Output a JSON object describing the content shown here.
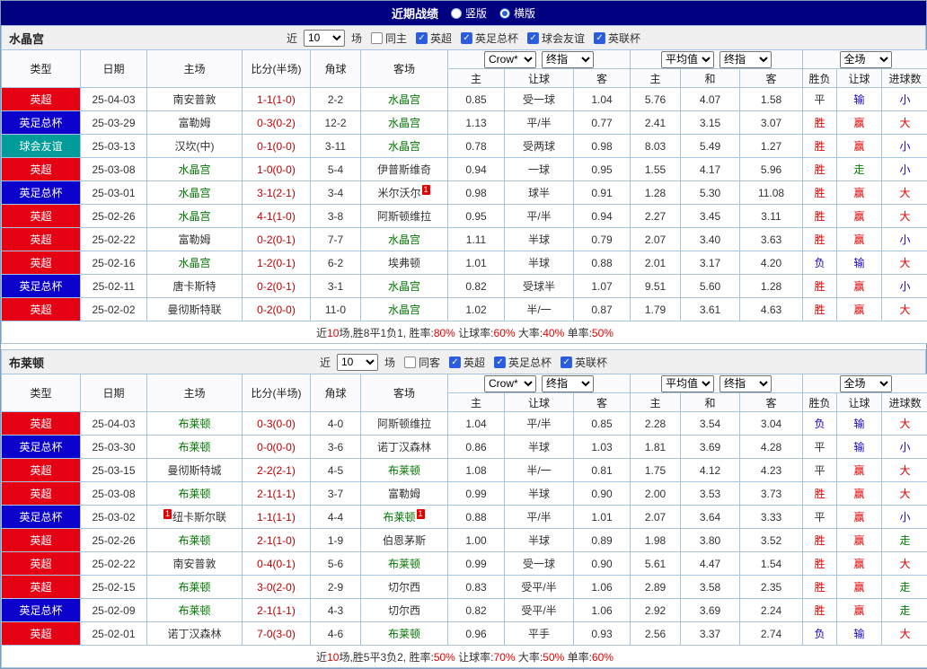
{
  "topbar": {
    "title": "近期战绩",
    "vertical_label": "竖版",
    "horizontal_label": "横版",
    "selected": "横版"
  },
  "table_headers": {
    "columns": [
      "类型",
      "日期",
      "主场",
      "比分(半场)",
      "角球",
      "客场"
    ],
    "odds_groups": [
      {
        "selects": [
          "Crow*",
          "终指"
        ],
        "subs": [
          "主",
          "让球",
          "客"
        ]
      },
      {
        "selects": [
          "平均值",
          "终指"
        ],
        "subs": [
          "主",
          "和",
          "客"
        ]
      },
      {
        "selects": [
          "全场"
        ],
        "subs": [
          "胜负",
          "让球",
          "进球数"
        ]
      }
    ]
  },
  "colors": {
    "topbar_bg": "#000080",
    "control_accent": "#2b5ce0",
    "badge": "#e60000",
    "score": "#bb0000",
    "focus_team": "#007500",
    "summary_highlight": "#e60000",
    "league": {
      "英超": "#e60014",
      "英足总杯": "#0c00cd",
      "球会友谊": "#009c9c"
    },
    "result": {
      "胜": "#e60000",
      "赢": "#e60000",
      "大": "#e60000",
      "平": "#333333",
      "负": "#1500cd",
      "输": "#1500cd",
      "小": "#1500cd",
      "走": "#008000"
    }
  },
  "sections": [
    {
      "team": "水晶宫",
      "filters": {
        "near": "近",
        "count": "10",
        "games": "场",
        "boxes": [
          {
            "label": "同主",
            "checked": false
          },
          {
            "label": "英超",
            "checked": true
          },
          {
            "label": "英足总杯",
            "checked": true
          },
          {
            "label": "球会友谊",
            "checked": true
          },
          {
            "label": "英联杯",
            "checked": true
          }
        ]
      },
      "rows": [
        {
          "league": "英超",
          "date": "25-04-03",
          "home": "南安普敦",
          "home_focus": false,
          "score": "1-1(1-0)",
          "corners": "2-2",
          "away": "水晶宫",
          "away_focus": true,
          "odds": [
            "0.85",
            "受一球",
            "1.04"
          ],
          "avg": [
            "5.76",
            "4.07",
            "1.58"
          ],
          "res": [
            "平",
            "输",
            "小"
          ]
        },
        {
          "league": "英足总杯",
          "date": "25-03-29",
          "home": "富勒姆",
          "home_focus": false,
          "score": "0-3(0-2)",
          "corners": "12-2",
          "away": "水晶宫",
          "away_focus": true,
          "odds": [
            "1.13",
            "平/半",
            "0.77"
          ],
          "avg": [
            "2.41",
            "3.15",
            "3.07"
          ],
          "res": [
            "胜",
            "赢",
            "大"
          ]
        },
        {
          "league": "球会友谊",
          "date": "25-03-13",
          "home": "汉坎(中)",
          "home_focus": false,
          "score": "0-1(0-0)",
          "corners": "3-11",
          "away": "水晶宫",
          "away_focus": true,
          "odds": [
            "0.78",
            "受两球",
            "0.98"
          ],
          "avg": [
            "8.03",
            "5.49",
            "1.27"
          ],
          "res": [
            "胜",
            "赢",
            "小"
          ]
        },
        {
          "league": "英超",
          "date": "25-03-08",
          "home": "水晶宫",
          "home_focus": true,
          "score": "1-0(0-0)",
          "corners": "5-4",
          "away": "伊普斯维奇",
          "away_focus": false,
          "odds": [
            "0.94",
            "一球",
            "0.95"
          ],
          "avg": [
            "1.55",
            "4.17",
            "5.96"
          ],
          "res": [
            "胜",
            "走",
            "小"
          ]
        },
        {
          "league": "英足总杯",
          "date": "25-03-01",
          "home": "水晶宫",
          "home_focus": true,
          "score": "3-1(2-1)",
          "corners": "3-4",
          "away": "米尔沃尔",
          "away_focus": false,
          "away_badge": "1",
          "odds": [
            "0.98",
            "球半",
            "0.91"
          ],
          "avg": [
            "1.28",
            "5.30",
            "11.08"
          ],
          "res": [
            "胜",
            "赢",
            "大"
          ]
        },
        {
          "league": "英超",
          "date": "25-02-26",
          "home": "水晶宫",
          "home_focus": true,
          "score": "4-1(1-0)",
          "corners": "3-8",
          "away": "阿斯顿维拉",
          "away_focus": false,
          "odds": [
            "0.95",
            "平/半",
            "0.94"
          ],
          "avg": [
            "2.27",
            "3.45",
            "3.11"
          ],
          "res": [
            "胜",
            "赢",
            "大"
          ]
        },
        {
          "league": "英超",
          "date": "25-02-22",
          "home": "富勒姆",
          "home_focus": false,
          "score": "0-2(0-1)",
          "corners": "7-7",
          "away": "水晶宫",
          "away_focus": true,
          "odds": [
            "1.11",
            "半球",
            "0.79"
          ],
          "avg": [
            "2.07",
            "3.40",
            "3.63"
          ],
          "res": [
            "胜",
            "赢",
            "小"
          ]
        },
        {
          "league": "英超",
          "date": "25-02-16",
          "home": "水晶宫",
          "home_focus": true,
          "score": "1-2(0-1)",
          "corners": "6-2",
          "away": "埃弗顿",
          "away_focus": false,
          "odds": [
            "1.01",
            "半球",
            "0.88"
          ],
          "avg": [
            "2.01",
            "3.17",
            "4.20"
          ],
          "res": [
            "负",
            "输",
            "大"
          ]
        },
        {
          "league": "英足总杯",
          "date": "25-02-11",
          "home": "唐卡斯特",
          "home_focus": false,
          "score": "0-2(0-1)",
          "corners": "3-1",
          "away": "水晶宫",
          "away_focus": true,
          "odds": [
            "0.82",
            "受球半",
            "1.07"
          ],
          "avg": [
            "9.51",
            "5.60",
            "1.28"
          ],
          "res": [
            "胜",
            "赢",
            "小"
          ]
        },
        {
          "league": "英超",
          "date": "25-02-02",
          "home": "曼彻斯特联",
          "home_focus": false,
          "score": "0-2(0-0)",
          "corners": "11-0",
          "away": "水晶宫",
          "away_focus": true,
          "odds": [
            "1.02",
            "半/一",
            "0.87"
          ],
          "avg": [
            "1.79",
            "3.61",
            "4.63"
          ],
          "res": [
            "胜",
            "赢",
            "大"
          ]
        }
      ],
      "summary": [
        {
          "t": "近"
        },
        {
          "t": "10",
          "hl": true
        },
        {
          "t": "场,胜8平1负1, 胜率:"
        },
        {
          "t": "80%",
          "hl": true
        },
        {
          "t": " 让球率:"
        },
        {
          "t": "60%",
          "hl": true
        },
        {
          "t": " 大率:"
        },
        {
          "t": "40%",
          "hl": true
        },
        {
          "t": " 单率:"
        },
        {
          "t": "50%",
          "hl": true
        }
      ]
    },
    {
      "team": "布莱顿",
      "filters": {
        "near": "近",
        "count": "10",
        "games": "场",
        "boxes": [
          {
            "label": "同客",
            "checked": false
          },
          {
            "label": "英超",
            "checked": true
          },
          {
            "label": "英足总杯",
            "checked": true
          },
          {
            "label": "英联杯",
            "checked": true
          }
        ]
      },
      "rows": [
        {
          "league": "英超",
          "date": "25-04-03",
          "home": "布莱顿",
          "home_focus": true,
          "score": "0-3(0-0)",
          "corners": "4-0",
          "away": "阿斯顿维拉",
          "away_focus": false,
          "odds": [
            "1.04",
            "平/半",
            "0.85"
          ],
          "avg": [
            "2.28",
            "3.54",
            "3.04"
          ],
          "res": [
            "负",
            "输",
            "大"
          ]
        },
        {
          "league": "英足总杯",
          "date": "25-03-30",
          "home": "布莱顿",
          "home_focus": true,
          "score": "0-0(0-0)",
          "corners": "3-6",
          "away": "诺丁汉森林",
          "away_focus": false,
          "odds": [
            "0.86",
            "半球",
            "1.03"
          ],
          "avg": [
            "1.81",
            "3.69",
            "4.28"
          ],
          "res": [
            "平",
            "输",
            "小"
          ]
        },
        {
          "league": "英超",
          "date": "25-03-15",
          "home": "曼彻斯特城",
          "home_focus": false,
          "score": "2-2(2-1)",
          "corners": "4-5",
          "away": "布莱顿",
          "away_focus": true,
          "odds": [
            "1.08",
            "半/一",
            "0.81"
          ],
          "avg": [
            "1.75",
            "4.12",
            "4.23"
          ],
          "res": [
            "平",
            "赢",
            "大"
          ]
        },
        {
          "league": "英超",
          "date": "25-03-08",
          "home": "布莱顿",
          "home_focus": true,
          "score": "2-1(1-1)",
          "corners": "3-7",
          "away": "富勒姆",
          "away_focus": false,
          "odds": [
            "0.99",
            "半球",
            "0.90"
          ],
          "avg": [
            "2.00",
            "3.53",
            "3.73"
          ],
          "res": [
            "胜",
            "赢",
            "大"
          ]
        },
        {
          "league": "英足总杯",
          "date": "25-03-02",
          "home": "纽卡斯尔联",
          "home_focus": false,
          "home_badge": "1",
          "score": "1-1(1-1)",
          "corners": "4-4",
          "away": "布莱顿",
          "away_focus": true,
          "away_badge": "1",
          "odds": [
            "0.88",
            "平/半",
            "1.01"
          ],
          "avg": [
            "2.07",
            "3.64",
            "3.33"
          ],
          "res": [
            "平",
            "赢",
            "小"
          ]
        },
        {
          "league": "英超",
          "date": "25-02-26",
          "home": "布莱顿",
          "home_focus": true,
          "score": "2-1(1-0)",
          "corners": "1-9",
          "away": "伯恩茅斯",
          "away_focus": false,
          "odds": [
            "1.00",
            "半球",
            "0.89"
          ],
          "avg": [
            "1.98",
            "3.80",
            "3.52"
          ],
          "res": [
            "胜",
            "赢",
            "走"
          ]
        },
        {
          "league": "英超",
          "date": "25-02-22",
          "home": "南安普敦",
          "home_focus": false,
          "score": "0-4(0-1)",
          "corners": "5-6",
          "away": "布莱顿",
          "away_focus": true,
          "odds": [
            "0.99",
            "受一球",
            "0.90"
          ],
          "avg": [
            "5.61",
            "4.47",
            "1.54"
          ],
          "res": [
            "胜",
            "赢",
            "大"
          ]
        },
        {
          "league": "英超",
          "date": "25-02-15",
          "home": "布莱顿",
          "home_focus": true,
          "score": "3-0(2-0)",
          "corners": "2-9",
          "away": "切尔西",
          "away_focus": false,
          "odds": [
            "0.83",
            "受平/半",
            "1.06"
          ],
          "avg": [
            "2.89",
            "3.58",
            "2.35"
          ],
          "res": [
            "胜",
            "赢",
            "走"
          ]
        },
        {
          "league": "英足总杯",
          "date": "25-02-09",
          "home": "布莱顿",
          "home_focus": true,
          "score": "2-1(1-1)",
          "corners": "4-3",
          "away": "切尔西",
          "away_focus": false,
          "odds": [
            "0.82",
            "受平/半",
            "1.06"
          ],
          "avg": [
            "2.92",
            "3.69",
            "2.24"
          ],
          "res": [
            "胜",
            "赢",
            "走"
          ]
        },
        {
          "league": "英超",
          "date": "25-02-01",
          "home": "诺丁汉森林",
          "home_focus": false,
          "score": "7-0(3-0)",
          "corners": "4-6",
          "away": "布莱顿",
          "away_focus": true,
          "odds": [
            "0.96",
            "平手",
            "0.93"
          ],
          "avg": [
            "2.56",
            "3.37",
            "2.74"
          ],
          "res": [
            "负",
            "输",
            "大"
          ]
        }
      ],
      "summary": [
        {
          "t": "近"
        },
        {
          "t": "10",
          "hl": true
        },
        {
          "t": "场,胜5平3负2, 胜率:"
        },
        {
          "t": "50%",
          "hl": true
        },
        {
          "t": " 让球率:"
        },
        {
          "t": "70%",
          "hl": true
        },
        {
          "t": " 大率:"
        },
        {
          "t": "50%",
          "hl": true
        },
        {
          "t": " 单率:"
        },
        {
          "t": "60%",
          "hl": true
        }
      ]
    }
  ]
}
